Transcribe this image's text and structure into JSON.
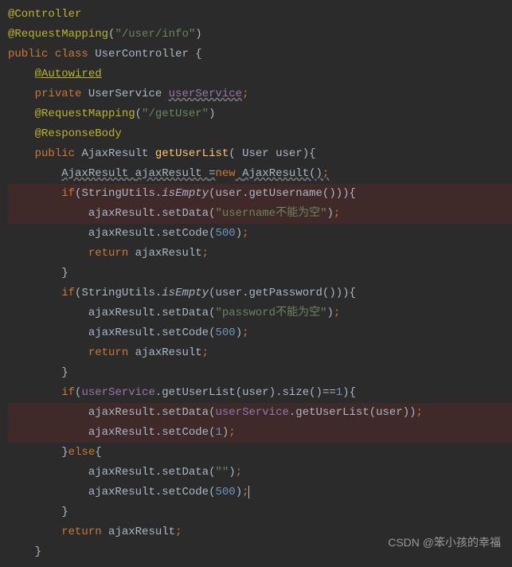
{
  "code": {
    "anno_controller": "@Controller",
    "anno_reqmap": "@RequestMapping",
    "anno_reqmap_class_arg": "\"/user/info\"",
    "kw_public": "public",
    "kw_class": "class",
    "cls_name": "UserController",
    "anno_autowired": "@Autowired",
    "kw_private": "private",
    "type_userservice": "UserService",
    "fld_userservice": "userService",
    "anno_reqmap_method_arg": "\"/getUser\"",
    "anno_respbody": "@ResponseBody",
    "type_ajaxresult": "AjaxResult",
    "fn_getuserlist": "getUserList",
    "param_user_type": "User",
    "param_user_name": "user",
    "var_ajaxresult": "ajaxResult",
    "kw_new": "new",
    "kw_if": "if",
    "kw_else": "else",
    "kw_return": "return",
    "cls_stringutils": "StringUtils",
    "fn_isempty": "isEmpty",
    "fn_getusername": "getUsername",
    "fn_getpassword": "getPassword",
    "fn_setdata": "setData",
    "fn_setcode": "setCode",
    "fn_getuserlist_call": "getUserList",
    "fn_size": "size",
    "str_username_empty": "\"username不能为空\"",
    "str_password_empty": "\"password不能为空\"",
    "str_empty": "\"\"",
    "num_500": "500",
    "num_1": "1",
    "semicolon": ";",
    "comma": ",",
    "dot": ".",
    "lparen": "(",
    "rparen": ")",
    "lbrace": "{",
    "rbrace": "}",
    "eq": "=",
    "eqeq": "==",
    "space": " "
  },
  "watermark": "CSDN @笨小孩的幸福"
}
